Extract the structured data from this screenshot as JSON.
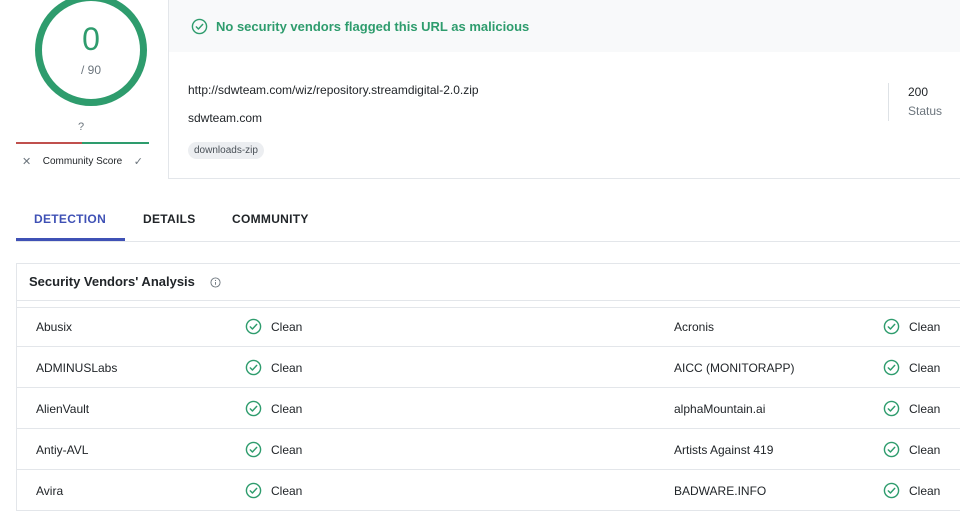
{
  "score": {
    "detections": "0",
    "total": "/ 90",
    "unknown": "?"
  },
  "community": {
    "label": "Community Score",
    "thumb_down": "✕",
    "thumb_up": "✓"
  },
  "banner": {
    "message": "No security vendors flagged this URL as malicious"
  },
  "details": {
    "url": "http://sdwteam.com/wiz/repository.streamdigital-2.0.zip",
    "domain": "sdwteam.com",
    "tag": "downloads-zip",
    "status_code": "200",
    "status_label": "Status"
  },
  "tabs": [
    {
      "label": "DETECTION",
      "active": true
    },
    {
      "label": "DETAILS",
      "active": false
    },
    {
      "label": "COMMUNITY",
      "active": false
    }
  ],
  "analysis": {
    "title": "Security Vendors' Analysis",
    "rows": [
      {
        "left": {
          "vendor": "Abusix",
          "verdict": "Clean"
        },
        "right": {
          "vendor": "Acronis",
          "verdict": "Clean"
        }
      },
      {
        "left": {
          "vendor": "ADMINUSLabs",
          "verdict": "Clean"
        },
        "right": {
          "vendor": "AICC (MONITORAPP)",
          "verdict": "Clean"
        }
      },
      {
        "left": {
          "vendor": "AlienVault",
          "verdict": "Clean"
        },
        "right": {
          "vendor": "alphaMountain.ai",
          "verdict": "Clean"
        }
      },
      {
        "left": {
          "vendor": "Antiy-AVL",
          "verdict": "Clean"
        },
        "right": {
          "vendor": "Artists Against 419",
          "verdict": "Clean"
        }
      },
      {
        "left": {
          "vendor": "Avira",
          "verdict": "Clean"
        },
        "right": {
          "vendor": "BADWARE.INFO",
          "verdict": "Clean"
        }
      }
    ]
  },
  "colors": {
    "clean": "#2e9c6d",
    "accent": "#3f51b5",
    "malicious": "#c0504d"
  }
}
